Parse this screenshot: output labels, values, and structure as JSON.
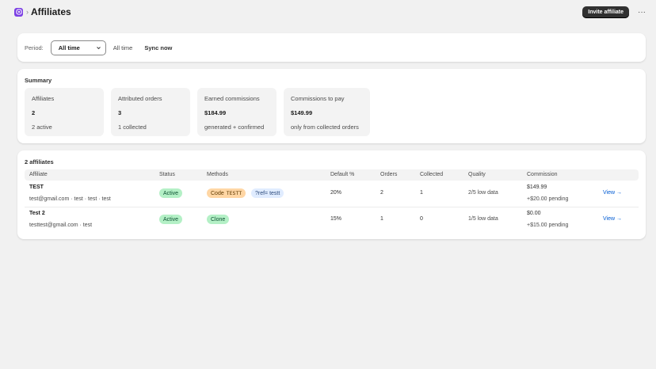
{
  "header": {
    "app_icon": "app-logo-icon",
    "breadcrumb_sep": "›",
    "title": "Affiliates",
    "invite_label": "Invite affiliate",
    "more_label": "···",
    "accent": "#7b3fe4"
  },
  "period": {
    "label": "Period:",
    "selected": "All time",
    "value_text": "All time",
    "sync_label": "Sync now"
  },
  "summary": {
    "title": "Summary",
    "stats": [
      {
        "label": "Affiliates",
        "value": "2",
        "sub": "2 active"
      },
      {
        "label": "Attributed orders",
        "value": "3",
        "sub": "1 collected"
      },
      {
        "label": "Earned commissions",
        "value": "$184.99",
        "sub": "generated + confirmed"
      },
      {
        "label": "Commissions to pay",
        "value": "$149.99",
        "sub": "only from collected orders"
      }
    ]
  },
  "table": {
    "title": "2 affiliates",
    "columns": [
      "Affiliate",
      "Status",
      "Methods",
      "Default %",
      "Orders",
      "Collected",
      "Quality",
      "Commission"
    ],
    "rows": [
      {
        "name": "TEST",
        "detail": "test@gmail.com · test · test · test",
        "status": "Active",
        "method_code_prefix": "Code",
        "method_code": "TESTT",
        "method_ref": "?ref= testt",
        "default_pct": "20%",
        "orders": "2",
        "collected": "1",
        "quality": "2/5 low data",
        "commission": "$149.99",
        "pending": "+$20.00 pending",
        "view": "View →"
      },
      {
        "name": "Test 2",
        "detail": "testtest@gmail.com · test",
        "status": "Active",
        "method_clone": "Clone",
        "default_pct": "15%",
        "orders": "1",
        "collected": "0",
        "quality": "1/5 low data",
        "commission": "$0.00",
        "pending": "+$15.00 pending",
        "view": "View →"
      }
    ]
  }
}
